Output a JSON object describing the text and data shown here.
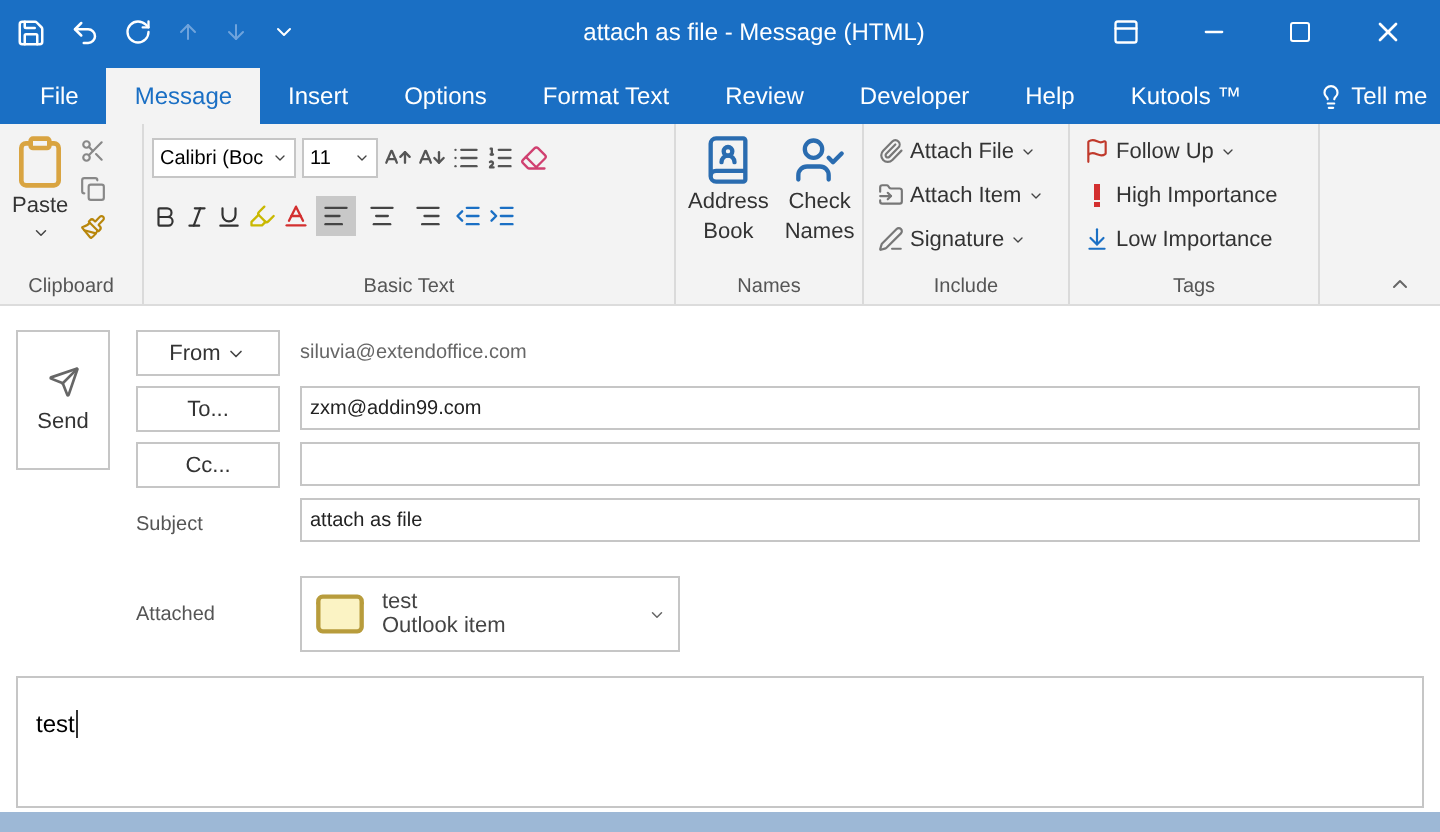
{
  "window": {
    "title": "attach as file  -  Message (HTML)"
  },
  "tabs": [
    {
      "label": "File",
      "selected": false
    },
    {
      "label": "Message",
      "selected": true
    },
    {
      "label": "Insert",
      "selected": false
    },
    {
      "label": "Options",
      "selected": false
    },
    {
      "label": "Format Text",
      "selected": false
    },
    {
      "label": "Review",
      "selected": false
    },
    {
      "label": "Developer",
      "selected": false
    },
    {
      "label": "Help",
      "selected": false
    },
    {
      "label": "Kutools ™",
      "selected": false
    }
  ],
  "tell_me": "Tell me",
  "ribbon": {
    "clipboard": {
      "label": "Clipboard",
      "paste": "Paste"
    },
    "basic_text": {
      "label": "Basic Text",
      "font": "Calibri (Boc",
      "size": "11",
      "alignments": [
        {
          "kind": "left",
          "selected": true
        },
        {
          "kind": "center",
          "selected": false
        },
        {
          "kind": "right",
          "selected": false
        }
      ]
    },
    "names": {
      "label": "Names",
      "buttons": [
        {
          "kind": "address",
          "label": "Address Book"
        },
        {
          "kind": "check",
          "label": "Check Names"
        }
      ]
    },
    "include": {
      "label": "Include",
      "items": [
        {
          "kind": "file",
          "label": "Attach File"
        },
        {
          "kind": "item",
          "label": "Attach Item"
        },
        {
          "kind": "signature",
          "label": "Signature"
        }
      ]
    },
    "tags": {
      "label": "Tags",
      "items": [
        {
          "kind": "flag",
          "label": "Follow Up",
          "dropdown": true
        },
        {
          "kind": "high",
          "label": "High Importance",
          "dropdown": false
        },
        {
          "kind": "low",
          "label": "Low Importance",
          "dropdown": false
        }
      ]
    }
  },
  "form": {
    "send": "Send",
    "from": {
      "label": "From",
      "value": "siluvia@extendoffice.com"
    },
    "to": {
      "label": "To...",
      "value": "zxm@addin99.com"
    },
    "cc": {
      "label": "Cc..."
    },
    "subject": {
      "label": "Subject",
      "value": "attach as file"
    },
    "attached": {
      "label": "Attached",
      "name": "test",
      "type": "Outlook item"
    }
  },
  "body": "test"
}
